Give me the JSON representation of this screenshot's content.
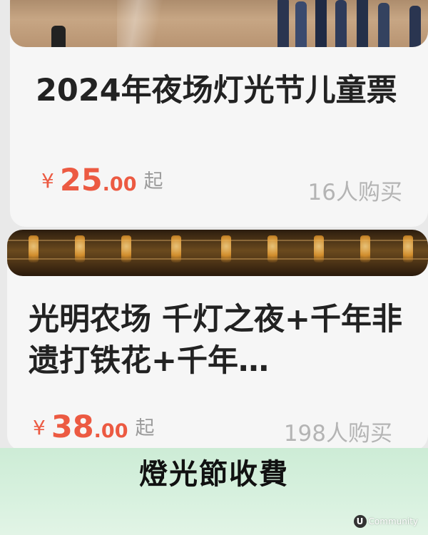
{
  "products": [
    {
      "title": "2024年夜场灯光节儿童票",
      "price": {
        "currency": "¥",
        "integer": "25",
        "decimal": ".00",
        "suffix": "起"
      },
      "sold": "16人购买",
      "photo": "people-on-plaza-image"
    },
    {
      "title": "光明农场 千灯之夜+千年非遗打铁花+千年…",
      "price": {
        "currency": "¥",
        "integer": "38",
        "decimal": ".00",
        "suffix": "起"
      },
      "sold": "198人购买",
      "photo": "lantern-night-image"
    }
  ],
  "overlay": {
    "caption": "燈光節收費"
  },
  "watermark": {
    "mark": "U",
    "text": "Community"
  },
  "colors": {
    "price": "#ec5a42",
    "sold": "#b4b4b4",
    "banner": "#d4efdb"
  }
}
